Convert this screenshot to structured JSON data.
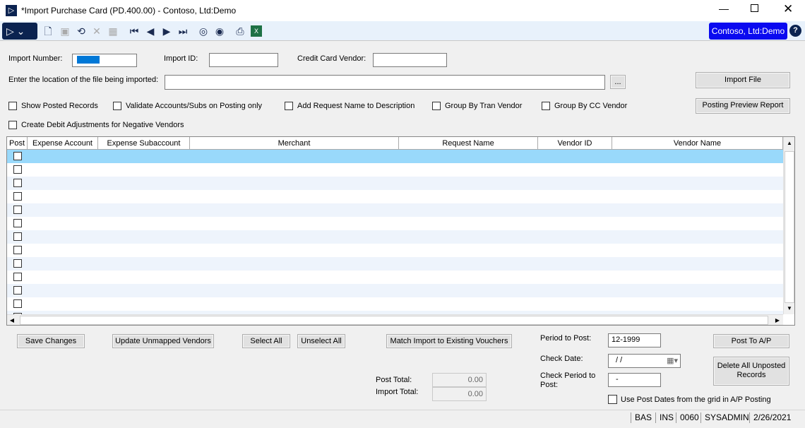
{
  "window": {
    "title": "*Import Purchase Card (PD.400.00) - Contoso, Ltd:Demo",
    "company": "Contoso, Ltd:Demo"
  },
  "toolbar": {
    "icons": [
      "new-icon",
      "save-icon",
      "refresh-icon",
      "delete-icon",
      "cancel-icon",
      "first-icon",
      "previous-icon",
      "next-icon",
      "last-icon",
      "autocomplete-icon",
      "view-icon",
      "print-icon",
      "excel-icon"
    ]
  },
  "form": {
    "import_number_label": "Import Number:",
    "import_number_value": "",
    "import_id_label": "Import ID:",
    "import_id_value": "",
    "cc_vendor_label": "Credit Card Vendor:",
    "cc_vendor_value": "",
    "file_location_label": "Enter the location of the file being imported:",
    "file_location_value": "",
    "browse_label": "...",
    "import_file_label": "Import File",
    "posting_preview_label": "Posting Preview Report",
    "checkboxes": [
      "Show Posted Records",
      "Validate Accounts/Subs on Posting only",
      "Add Request Name to Description",
      "Group By Tran Vendor",
      "Group By CC Vendor",
      "Create Debit Adjustments for Negative Vendors"
    ]
  },
  "grid": {
    "columns": [
      "Post",
      "Expense Account",
      "Expense Subaccount",
      "Merchant",
      "Request Name",
      "Vendor ID",
      "Vendor Name"
    ],
    "row_count": 13
  },
  "footer": {
    "save_changes": "Save Changes",
    "update_unmapped": "Update Unmapped Vendors",
    "select_all": "Select All",
    "unselect_all": "Unselect All",
    "match_import": "Match Import to Existing Vouchers",
    "period_label": "Period to Post:",
    "period_value": "12-1999",
    "check_date_label": "Check Date:",
    "check_date_value": " / /",
    "check_period_label": "Check Period to Post:",
    "check_period_value": "-",
    "post_total_label": "Post Total:",
    "post_total_value": "0.00",
    "import_total_label": "Import Total:",
    "import_total_value": "0.00",
    "post_ap": "Post To A/P",
    "delete_unposted": "Delete All Unposted Records",
    "use_post_dates": "Use Post Dates from the grid in A/P Posting"
  },
  "status": [
    "BAS",
    "INS",
    "0060",
    "SYSADMIN",
    "2/26/2021"
  ],
  "colors": {
    "selected_row": "#99d9fb",
    "alt_row": "#eef4fc",
    "company_badge": "#0a0af0",
    "nav_button": "#0b2350"
  }
}
